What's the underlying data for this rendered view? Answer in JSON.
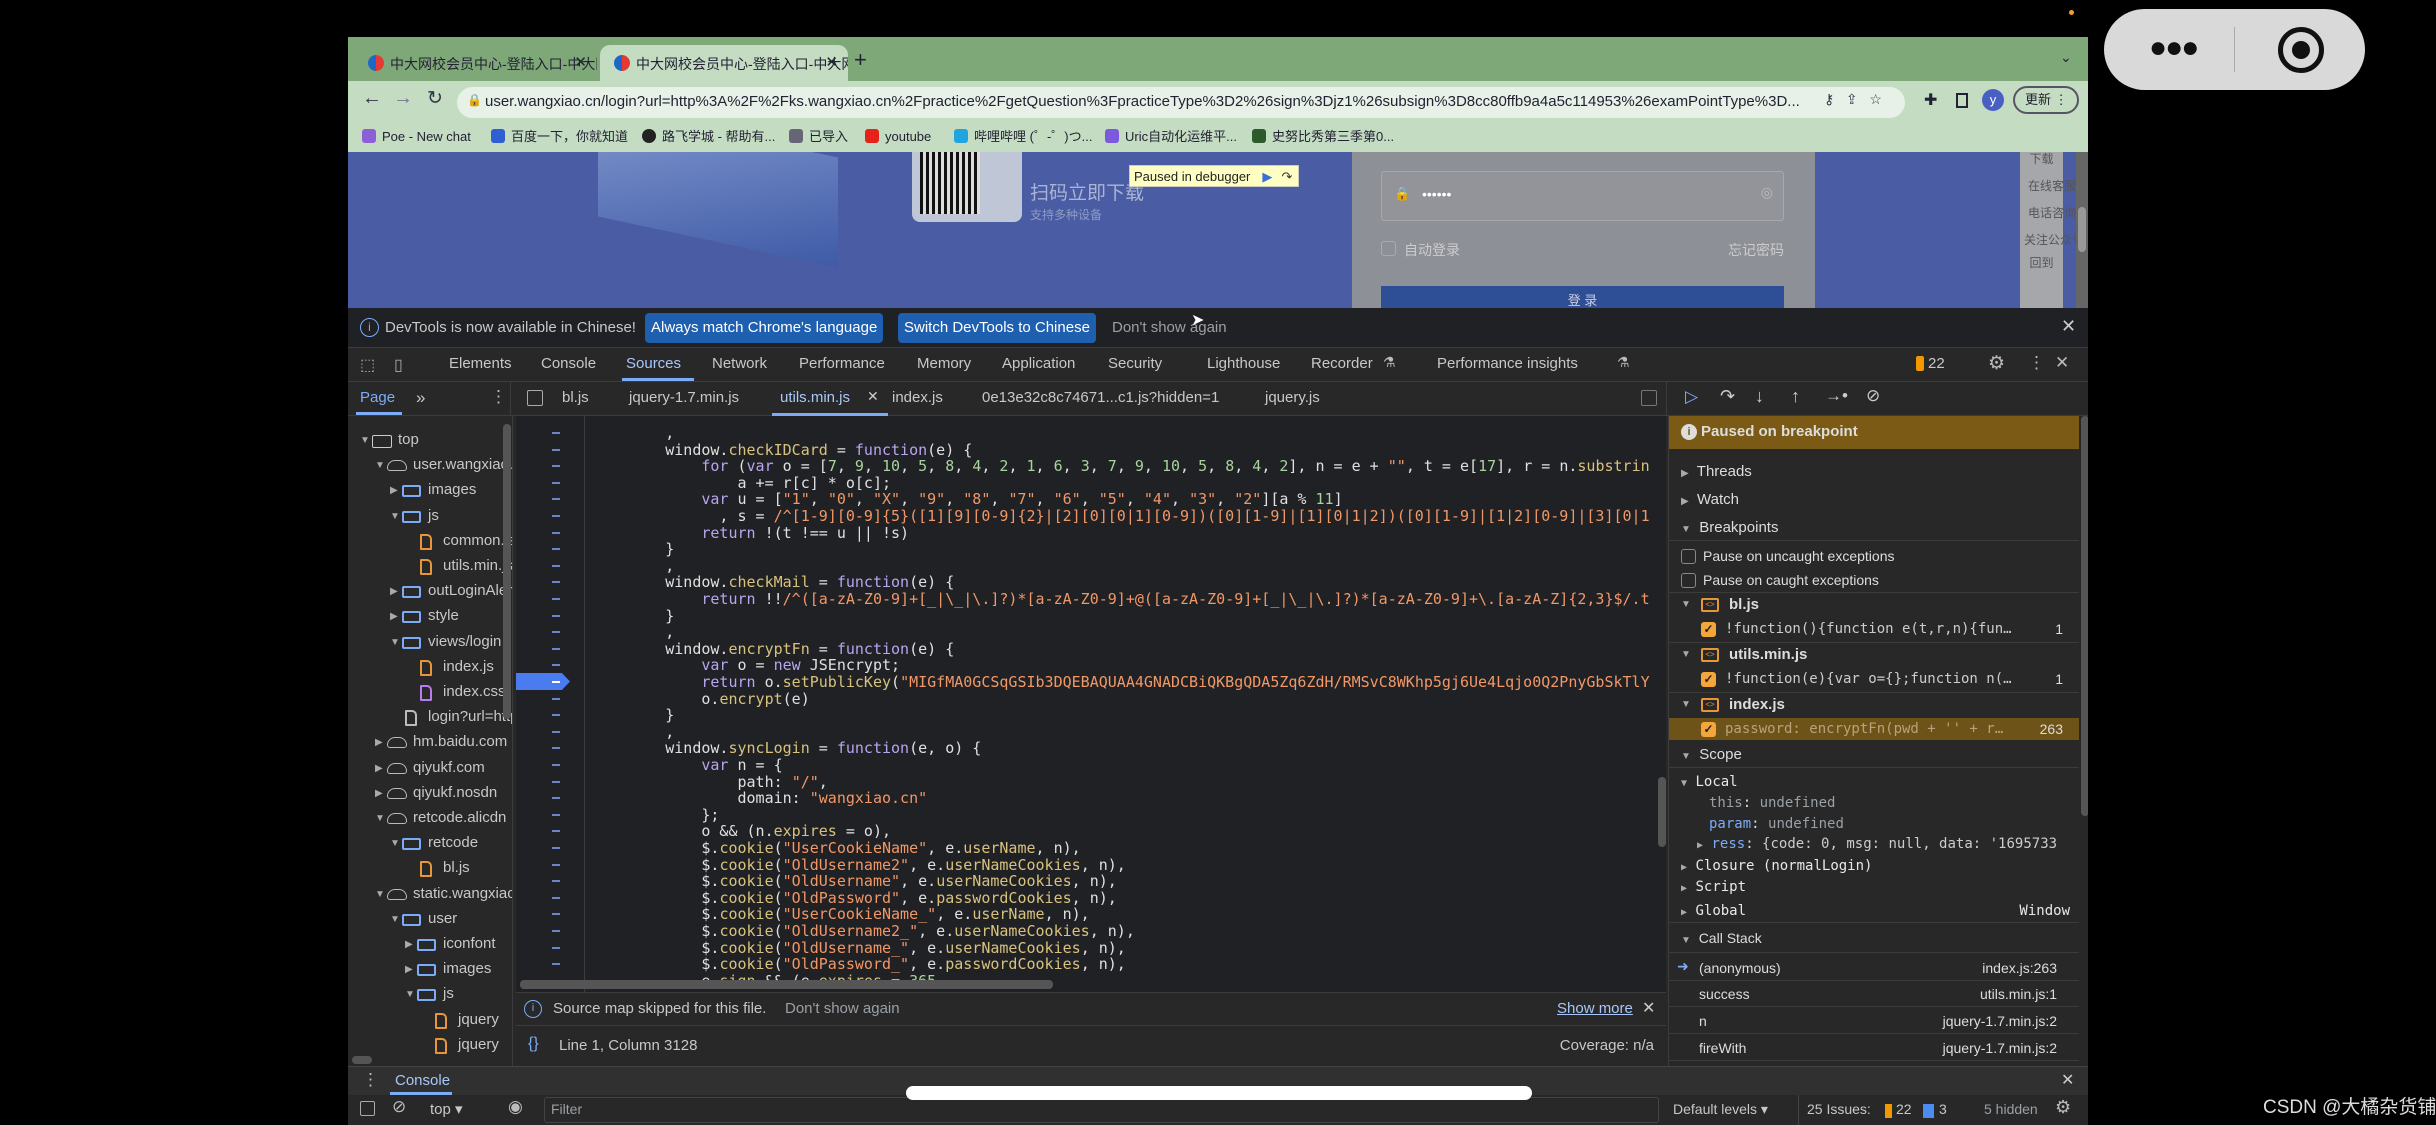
{
  "browser": {
    "tabs": [
      {
        "title": "中大网校会员中心-登陆入口-中大网校"
      },
      {
        "title": "中大网校会员中心-登陆入口-中大网校",
        "active": true
      }
    ],
    "new_tab": "+",
    "url": "user.wangxiao.cn/login?url=http%3A%2F%2Fks.wangxiao.cn%2Fpractice%2FgetQuestion%3FpracticeType%3D2%26sign%3Djz1%26subsign%3D8cc80ffb9a4a5c114953%26examPointType%3D...",
    "profile_initial": "y",
    "update_label": "更新",
    "bookmarks": [
      "Poe - New chat",
      "百度一下，你就知道",
      "路飞学城 - 帮助有...",
      "已导入",
      "youtube",
      "哔哩哔哩 (゜-゜)つ...",
      "Uric自动化运维平...",
      "史努比秀第三季第0..."
    ]
  },
  "page": {
    "qr_title": "扫码立即下载",
    "qr_sub": "支持多种设备",
    "paused_badge": "Paused in debugger",
    "password_mask": "••••••",
    "auto_login": "自动登录",
    "forgot": "忘记密码",
    "login_btn": "登 录",
    "side": [
      "下载",
      "在线客服",
      "电话咨询",
      "关注公众号",
      "回到"
    ]
  },
  "banner": {
    "text": "DevTools is now available in Chinese!",
    "btn1": "Always match Chrome's language",
    "btn2": "Switch DevTools to Chinese",
    "dismiss": "Don't show again"
  },
  "toolbar": {
    "tabs": [
      "Elements",
      "Console",
      "Sources",
      "Network",
      "Performance",
      "Memory",
      "Application",
      "Security",
      "Lighthouse",
      "Recorder",
      "Performance insights"
    ],
    "active": "Sources",
    "issues": "22"
  },
  "sources": {
    "nav_tab": "Page",
    "more": "»",
    "files": [
      "bl.js",
      "jquery-1.7.min.js",
      "utils.min.js",
      "index.js",
      "0e13e32c8c74671...c1.js?hidden=1",
      "jquery.js"
    ],
    "active_file": "utils.min.js",
    "tree": [
      {
        "label": "top",
        "depth": 0,
        "icon": "frame",
        "open": true
      },
      {
        "label": "user.wangxiao.cn",
        "depth": 1,
        "icon": "cloud",
        "open": true
      },
      {
        "label": "images",
        "depth": 2,
        "icon": "folder",
        "open": false
      },
      {
        "label": "js",
        "depth": 2,
        "icon": "folder",
        "open": true
      },
      {
        "label": "common.js",
        "depth": 3,
        "icon": "file"
      },
      {
        "label": "utils.min.js",
        "depth": 3,
        "icon": "file"
      },
      {
        "label": "outLoginAlert",
        "depth": 2,
        "icon": "folder",
        "open": false
      },
      {
        "label": "style",
        "depth": 2,
        "icon": "folder",
        "open": false
      },
      {
        "label": "views/login",
        "depth": 2,
        "icon": "folder",
        "open": true
      },
      {
        "label": "index.js",
        "depth": 3,
        "icon": "file"
      },
      {
        "label": "index.css",
        "depth": 3,
        "icon": "css"
      },
      {
        "label": "login?url=http",
        "depth": 2,
        "icon": "doc"
      },
      {
        "label": "hm.baidu.com",
        "depth": 1,
        "icon": "cloud",
        "open": false
      },
      {
        "label": "qiyukf.com",
        "depth": 1,
        "icon": "cloud",
        "open": false
      },
      {
        "label": "qiyukf.nosdn",
        "depth": 1,
        "icon": "cloud",
        "open": false
      },
      {
        "label": "retcode.alicdn",
        "depth": 1,
        "icon": "cloud",
        "open": true
      },
      {
        "label": "retcode",
        "depth": 2,
        "icon": "folder",
        "open": true
      },
      {
        "label": "bl.js",
        "depth": 3,
        "icon": "file"
      },
      {
        "label": "static.wangxiao",
        "depth": 1,
        "icon": "cloud",
        "open": true
      },
      {
        "label": "user",
        "depth": 2,
        "icon": "folder",
        "open": true
      },
      {
        "label": "iconfont",
        "depth": 3,
        "icon": "folder",
        "open": false
      },
      {
        "label": "images",
        "depth": 3,
        "icon": "folder",
        "open": false
      },
      {
        "label": "js",
        "depth": 3,
        "icon": "folder",
        "open": true
      },
      {
        "label": "jquery",
        "depth": 4,
        "icon": "file"
      },
      {
        "label": "jquery",
        "depth": 4,
        "icon": "file"
      }
    ],
    "code": [
      "        ,",
      "        window.checkIDCard = function(e) {",
      "            for (var o = [7, 9, 10, 5, 8, 4, 2, 1, 6, 3, 7, 9, 10, 5, 8, 4, 2], n = e + \"\", t = e[17], r = n.substrin",
      "                a += r[c] * o[c];",
      "            var u = [\"1\", \"0\", \"X\", \"9\", \"8\", \"7\", \"6\", \"5\", \"4\", \"3\", \"2\"][a % 11]",
      "              , s = /^[1-9][0-9]{5}([1][9][0-9]{2}|[2][0][0|1][0-9])([0][1-9]|[1][0|1|2])([0][1-9]|[1|2][0-9]|[3][0|1",
      "            return !(t !== u || !s)",
      "        }",
      "        ,",
      "        window.checkMail = function(e) {",
      "            return !!/^([a-zA-Z0-9]+[_|\\_|\\.]?)*[a-zA-Z0-9]+@([a-zA-Z0-9]+[_|\\_|\\.]?)*[a-zA-Z0-9]+\\.[a-zA-Z]{2,3}$/.t",
      "        }",
      "        ,",
      "        window.encryptFn = function(e) {",
      "            var o = new JSEncrypt;",
      "            return o.setPublicKey(\"MIGfMA0GCSqGSIb3DQEBAQUAA4GNADCBiQKBgQDA5Zq6ZdH/RMSvC8WKhp5gj6Ue4Lqjo0Q2PnyGbSkTlY",
      "            o.encrypt(e)",
      "        }",
      "        ,",
      "        window.syncLogin = function(e, o) {",
      "            var n = {",
      "                path: \"/\",",
      "                domain: \"wangxiao.cn\"",
      "            };",
      "            o && (n.expires = o),",
      "            $.cookie(\"UserCookieName\", e.userName, n),",
      "            $.cookie(\"OldUsername2\", e.userNameCookies, n),",
      "            $.cookie(\"OldUsername\", e.userNameCookies, n),",
      "            $.cookie(\"OldPassword\", e.passwordCookies, n),",
      "            $.cookie(\"UserCookieName_\", e.userName, n),",
      "            $.cookie(\"OldUsername2_\", e.userNameCookies, n),",
      "            $.cookie(\"OldUsername_\", e.userNameCookies, n),",
      "            $.cookie(\"OldPassword_\", e.passwordCookies, n),",
      "            e.sign && (e.expires = 365"
    ],
    "breakpoint_line_index": 15,
    "infobar": {
      "text": "Source map skipped for this file.",
      "dismiss": "Don't show again",
      "more": "Show more"
    },
    "status": {
      "position": "Line 1, Column 3128",
      "coverage": "Coverage: n/a"
    }
  },
  "debugger": {
    "paused": "Paused on breakpoint",
    "threads": "Threads",
    "watch": "Watch",
    "breakpoints": "Breakpoints",
    "uncaught": "Pause on uncaught exceptions",
    "caught": "Pause on caught exceptions",
    "bp_files": [
      {
        "file": "bl.js",
        "code": "!function(){function e(t,r,n){fun…",
        "line": "1"
      },
      {
        "file": "utils.min.js",
        "code": "!function(e){var o={};function n(…",
        "line": "1"
      },
      {
        "file": "index.js",
        "code": "password: encryptFn(pwd + '' + r…",
        "line": "263"
      }
    ],
    "scope": "Scope",
    "local": "Local",
    "vars": [
      {
        "k": "this",
        "v": "undefined"
      },
      {
        "k": "param",
        "v": "undefined"
      },
      {
        "k": "ress",
        "v": "{code: 0, msg: null, data: '1695733"
      }
    ],
    "closure": "Closure (normalLogin)",
    "script": "Script",
    "global": "Global",
    "global_val": "Window",
    "callstack": "Call Stack",
    "frames": [
      {
        "fn": "(anonymous)",
        "loc": "index.js:263"
      },
      {
        "fn": "success",
        "loc": "utils.min.js:1"
      },
      {
        "fn": "n",
        "loc": "jquery-1.7.min.js:2"
      },
      {
        "fn": "fireWith",
        "loc": "jquery-1.7.min.js:2"
      }
    ]
  },
  "console": {
    "tab": "Console",
    "context": "top ▾",
    "filter_placeholder": "Filter",
    "levels": "Default levels ▾",
    "issues_label": "25 Issues:",
    "warn": "22",
    "info": "3",
    "hidden": "5 hidden"
  },
  "watermark": "CSDN @大橘杂货铺",
  "colors": {
    "paused_bg": "#7a5a14",
    "accent": "#7cacf8",
    "breakpoint": "#4a7cf0"
  }
}
